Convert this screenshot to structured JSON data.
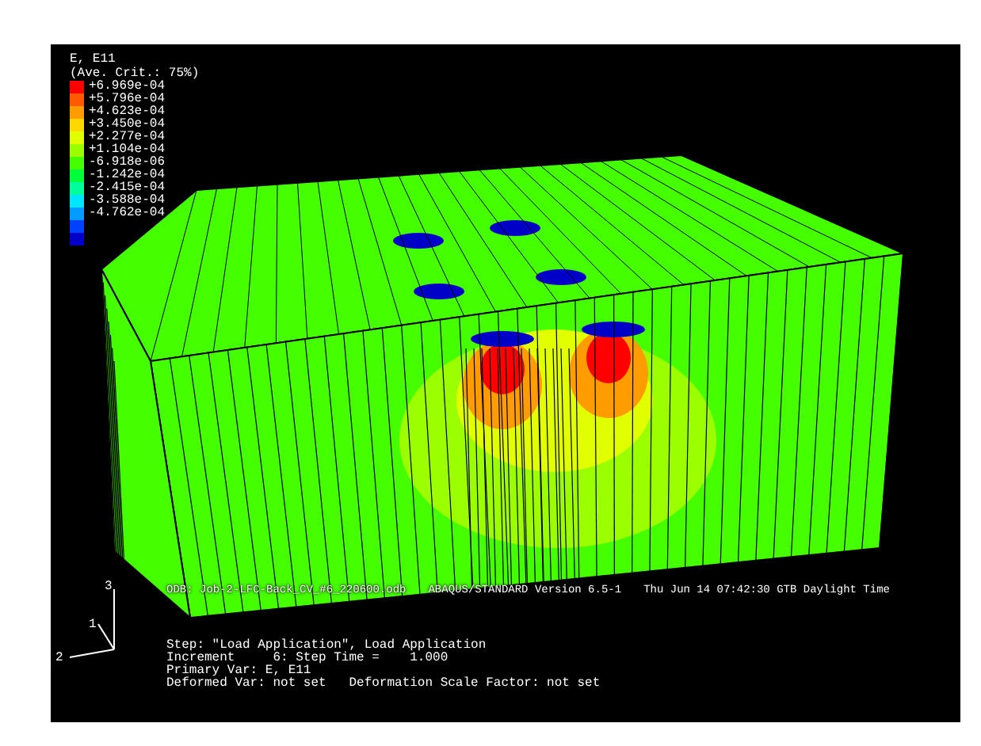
{
  "legend": {
    "title": "E, E11",
    "subtitle": "(Ave. Crit.: 75%)",
    "entries": [
      {
        "label": "+6.969e-04",
        "color": "#ff0000"
      },
      {
        "label": "+5.796e-04",
        "color": "#ff5a00"
      },
      {
        "label": "+4.623e-04",
        "color": "#ff9c00"
      },
      {
        "label": "+3.450e-04",
        "color": "#ffd800"
      },
      {
        "label": "+2.277e-04",
        "color": "#e2ff00"
      },
      {
        "label": "+1.104e-04",
        "color": "#9cff00"
      },
      {
        "label": "-6.918e-06",
        "color": "#45ff00"
      },
      {
        "label": "-1.242e-04",
        "color": "#00ff3a"
      },
      {
        "label": "-2.415e-04",
        "color": "#00ff9c"
      },
      {
        "label": "-3.588e-04",
        "color": "#00e6ff"
      },
      {
        "label": "-4.762e-04",
        "color": "#009cff"
      },
      {
        "color": "#0040ff"
      },
      {
        "color": "#0000c8"
      }
    ]
  },
  "info": {
    "odb": "ODB: Job-2-LFC-Back_CV_#6_220600.odb",
    "version": "ABAQUS/STANDARD Version 6.5-1",
    "date": "Thu Jun 14 07:42:30 GTB Daylight Time"
  },
  "step_lines": [
    "Step: \"Load Application\", Load Application",
    "Increment     6: Step Time =    1.000",
    "Primary Var: E, E11",
    "Deformed Var: not set   Deformation Scale Factor: not set"
  ],
  "triad": {
    "axis_1": "1",
    "axis_2": "2",
    "axis_3": "3"
  }
}
